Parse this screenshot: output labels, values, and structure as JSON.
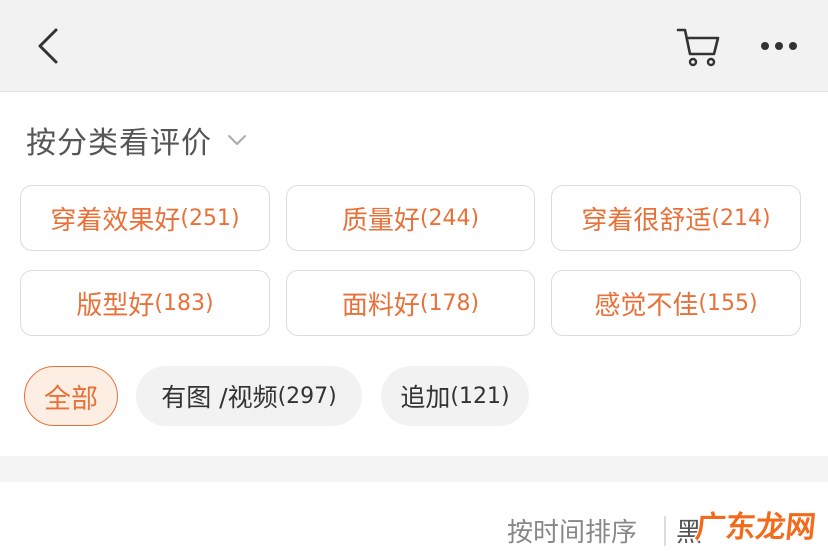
{
  "header": {
    "back_icon": "chevron-left-icon",
    "cart_icon": "shopping-cart-icon",
    "more_icon": "more-dots-icon"
  },
  "section": {
    "title": "按分类看评价"
  },
  "tags": [
    {
      "name": "穿着效果好",
      "count": "(251)"
    },
    {
      "name": "质量好",
      "count": "(244)"
    },
    {
      "name": "穿着很舒适",
      "count": "(214)"
    },
    {
      "name": "版型好",
      "count": "(183)"
    },
    {
      "name": "面料好",
      "count": "(178)"
    },
    {
      "name": "感觉不佳",
      "count": "(155)"
    }
  ],
  "filters": [
    {
      "name": "全部",
      "count": ""
    },
    {
      "name": "有图 /视频",
      "count": "(297)"
    },
    {
      "name": "追加",
      "count": "(121)"
    }
  ],
  "sort": {
    "label": "按时间排序",
    "partial": "黑"
  },
  "watermark": "广东龙网",
  "colors": {
    "accent": "#e8713a",
    "header_bg": "#f2f2f2"
  }
}
